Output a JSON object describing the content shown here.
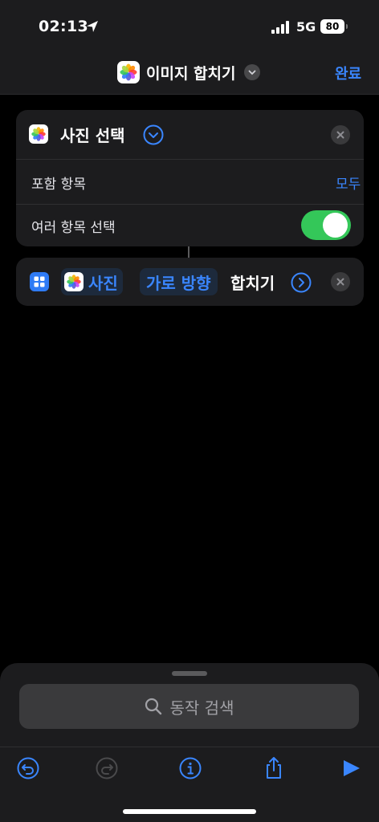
{
  "status": {
    "time": "02:13",
    "network": "5G",
    "battery": "80"
  },
  "nav": {
    "title": "이미지 합치기",
    "done_label": "완료"
  },
  "select_photos": {
    "title": "사진 선택",
    "include_label": "포함 항목",
    "include_value": "모두",
    "multi_label": "여러 항목 선택",
    "multi_enabled": true
  },
  "combine_action": {
    "photos_param": "사진",
    "direction_param": "가로 방향",
    "action_word": "합치기"
  },
  "search": {
    "placeholder": "동작 검색"
  },
  "colors": {
    "accent": "#3a86ff",
    "toggle_on": "#34c759",
    "panel": "#1c1c1e"
  },
  "icons": [
    "location-arrow-icon",
    "signal-icon",
    "photos-app-icon",
    "chevron-down-icon",
    "close-icon",
    "grid-icon",
    "chevron-right-icon",
    "search-icon",
    "undo-icon",
    "redo-icon",
    "info-icon",
    "share-icon",
    "play-icon"
  ]
}
